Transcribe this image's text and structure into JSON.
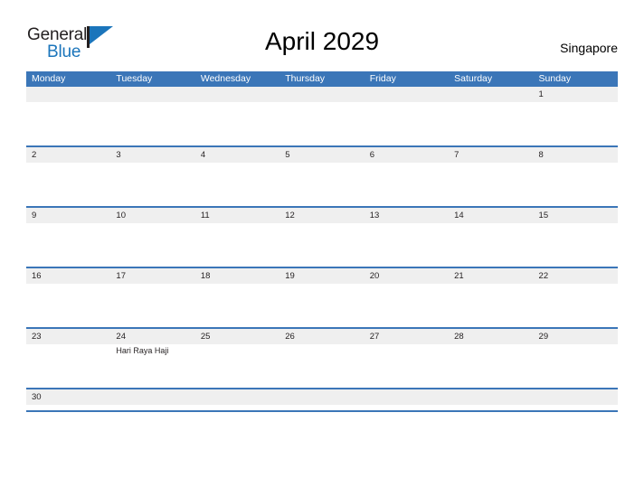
{
  "brand": {
    "name_top": "General",
    "name_bottom": "Blue",
    "flag_icon": "flag-icon",
    "accent_color": "#1b75bb",
    "text_color": "#231f20"
  },
  "header": {
    "title": "April 2029",
    "locale": "Singapore"
  },
  "calendar": {
    "header_color": "#3b76b8",
    "date_strip_color": "#efefef",
    "weekdays": [
      "Monday",
      "Tuesday",
      "Wednesday",
      "Thursday",
      "Friday",
      "Saturday",
      "Sunday"
    ],
    "weeks": [
      {
        "days": [
          {
            "num": "",
            "event": ""
          },
          {
            "num": "",
            "event": ""
          },
          {
            "num": "",
            "event": ""
          },
          {
            "num": "",
            "event": ""
          },
          {
            "num": "",
            "event": ""
          },
          {
            "num": "",
            "event": ""
          },
          {
            "num": "1",
            "event": ""
          }
        ]
      },
      {
        "days": [
          {
            "num": "2",
            "event": ""
          },
          {
            "num": "3",
            "event": ""
          },
          {
            "num": "4",
            "event": ""
          },
          {
            "num": "5",
            "event": ""
          },
          {
            "num": "6",
            "event": ""
          },
          {
            "num": "7",
            "event": ""
          },
          {
            "num": "8",
            "event": ""
          }
        ]
      },
      {
        "days": [
          {
            "num": "9",
            "event": ""
          },
          {
            "num": "10",
            "event": ""
          },
          {
            "num": "11",
            "event": ""
          },
          {
            "num": "12",
            "event": ""
          },
          {
            "num": "13",
            "event": ""
          },
          {
            "num": "14",
            "event": ""
          },
          {
            "num": "15",
            "event": ""
          }
        ]
      },
      {
        "days": [
          {
            "num": "16",
            "event": ""
          },
          {
            "num": "17",
            "event": ""
          },
          {
            "num": "18",
            "event": ""
          },
          {
            "num": "19",
            "event": ""
          },
          {
            "num": "20",
            "event": ""
          },
          {
            "num": "21",
            "event": ""
          },
          {
            "num": "22",
            "event": ""
          }
        ]
      },
      {
        "days": [
          {
            "num": "23",
            "event": ""
          },
          {
            "num": "24",
            "event": "Hari Raya Haji"
          },
          {
            "num": "25",
            "event": ""
          },
          {
            "num": "26",
            "event": ""
          },
          {
            "num": "27",
            "event": ""
          },
          {
            "num": "28",
            "event": ""
          },
          {
            "num": "29",
            "event": ""
          }
        ]
      },
      {
        "days": [
          {
            "num": "30",
            "event": ""
          },
          {
            "num": "",
            "event": ""
          },
          {
            "num": "",
            "event": ""
          },
          {
            "num": "",
            "event": ""
          },
          {
            "num": "",
            "event": ""
          },
          {
            "num": "",
            "event": ""
          },
          {
            "num": "",
            "event": ""
          }
        ]
      }
    ]
  }
}
